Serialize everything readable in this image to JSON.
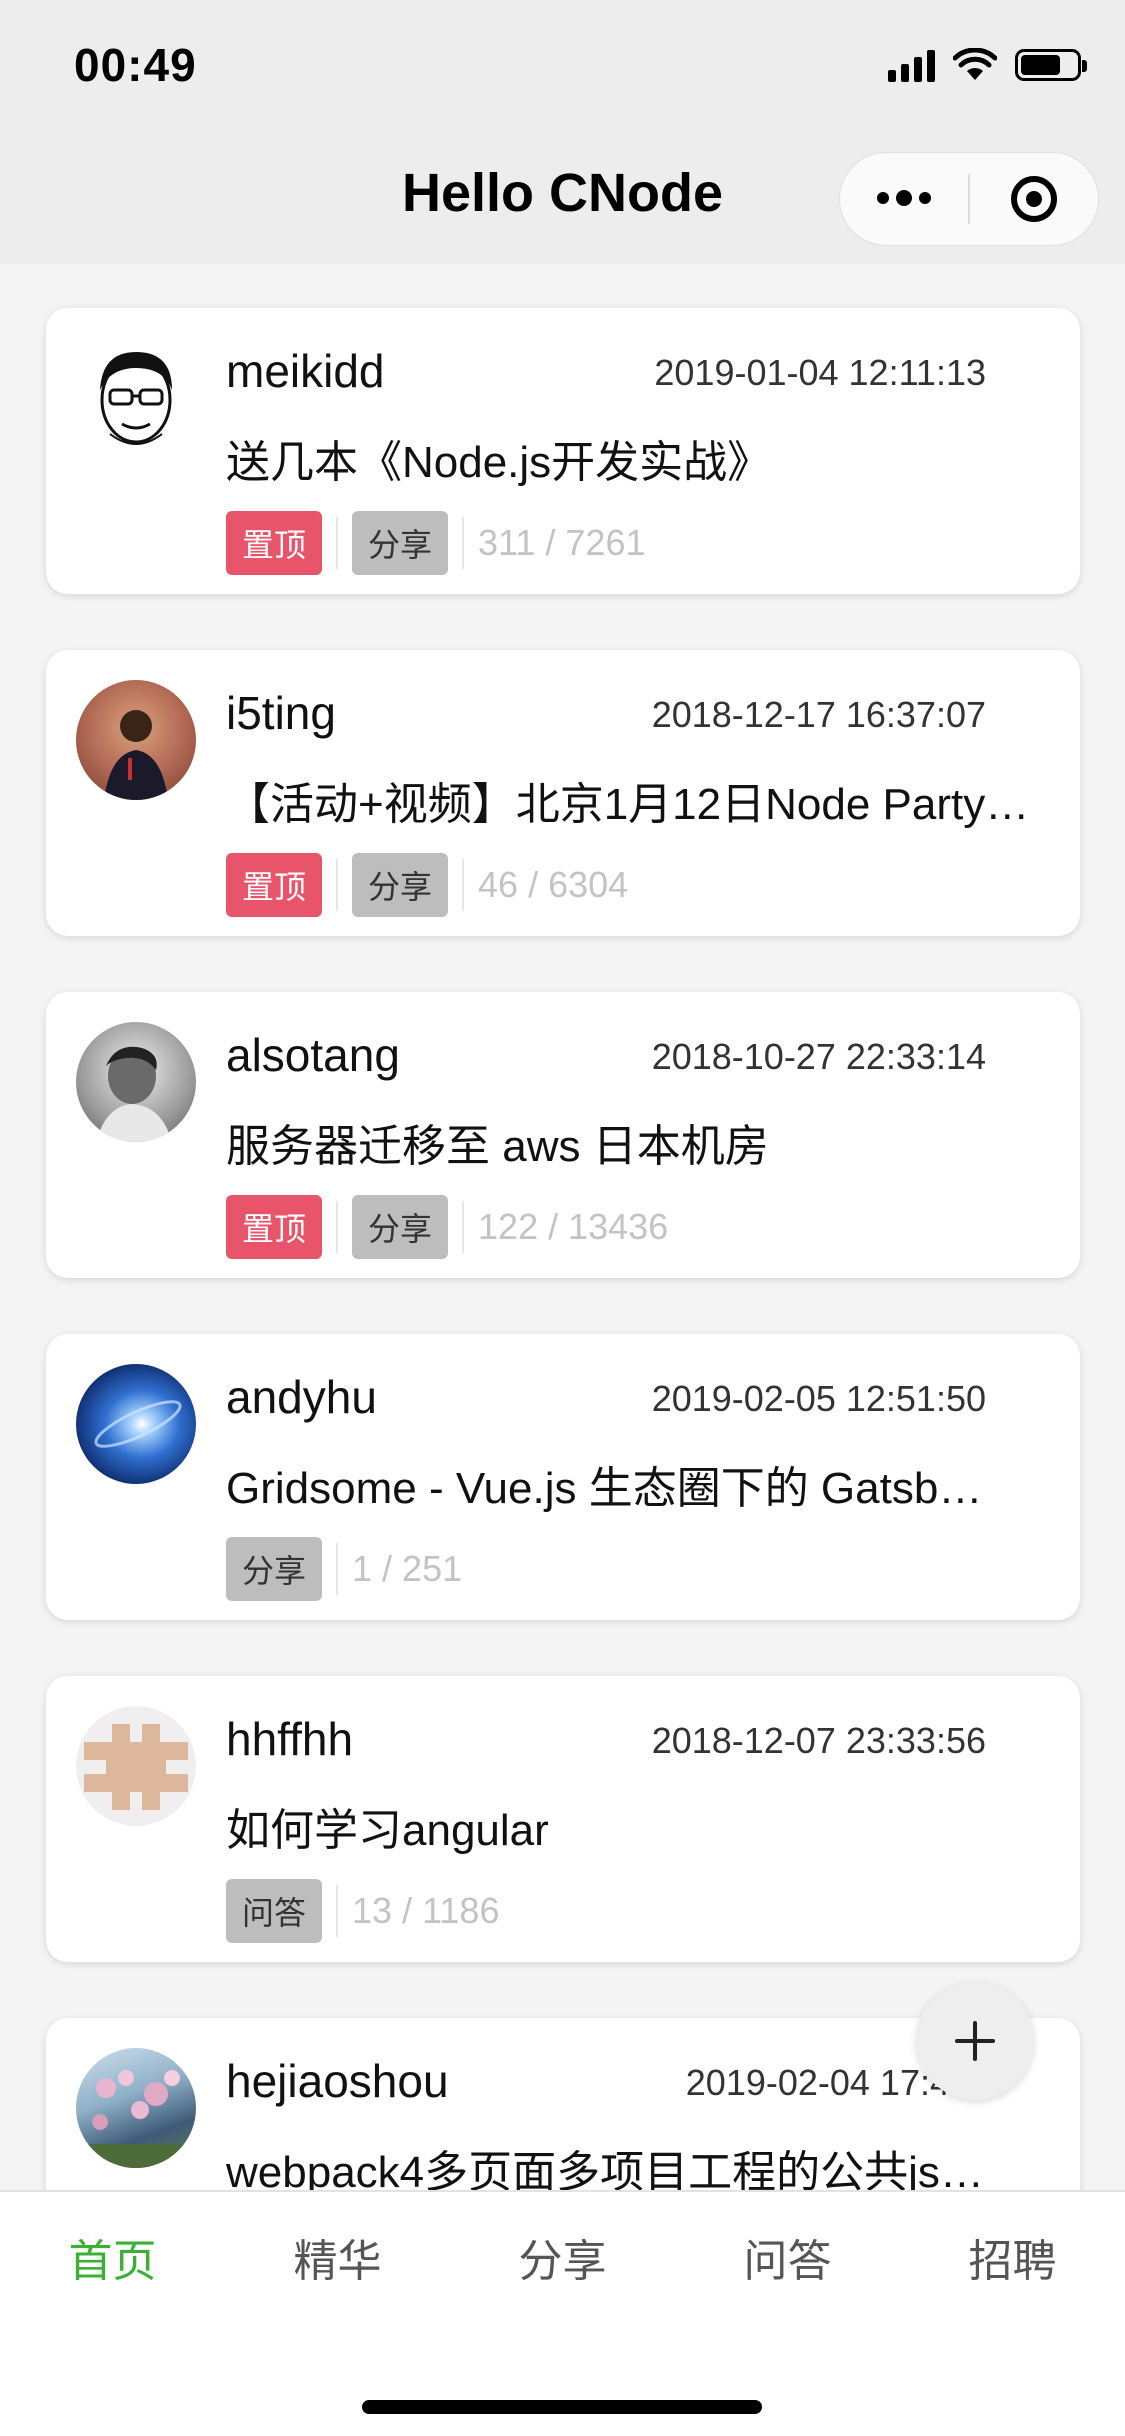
{
  "status": {
    "time": "00:49"
  },
  "nav": {
    "title": "Hello CNode"
  },
  "topics": [
    {
      "username": "meikidd",
      "date": "2019-01-04 12:11:13",
      "title": "送几本《Node.js开发实战》",
      "top_tag": "置顶",
      "category": "分享",
      "counts": "311 / 7261",
      "avatar": "cartoon-face-avatar"
    },
    {
      "username": "i5ting",
      "date": "2018-12-17 16:37:07",
      "title": "【活动+视频】北京1月12日Node Party…",
      "top_tag": "置顶",
      "category": "分享",
      "counts": "46 / 6304",
      "avatar": "person-photo-avatar"
    },
    {
      "username": "alsotang",
      "date": "2018-10-27 22:33:14",
      "title": "服务器迁移至 aws 日本机房",
      "top_tag": "置顶",
      "category": "分享",
      "counts": "122 / 13436",
      "avatar": "grayscale-portrait-avatar"
    },
    {
      "username": "andyhu",
      "date": "2019-02-05 12:51:50",
      "title": "Gridsome - Vue.js 生态圈下的 Gatsb…",
      "category": "分享",
      "counts": "1 / 251",
      "avatar": "galaxy-avatar"
    },
    {
      "username": "hhffhh",
      "date": "2018-12-07 23:33:56",
      "title": "如何学习angular",
      "category": "问答",
      "counts": "13 / 1186",
      "avatar": "pixel-pattern-avatar"
    },
    {
      "username": "hejiaoshou",
      "date": "2019-02-04 17:4…",
      "title": "webpack4多页面多项目工程的公共js…",
      "avatar": "flowers-photo-avatar"
    }
  ],
  "tabs": [
    "首页",
    "精华",
    "分享",
    "问答",
    "招聘"
  ],
  "colors": {
    "active_tab": "#3cb034",
    "top_tag": "#e8546a",
    "category_tag": "#bdbdbd"
  }
}
